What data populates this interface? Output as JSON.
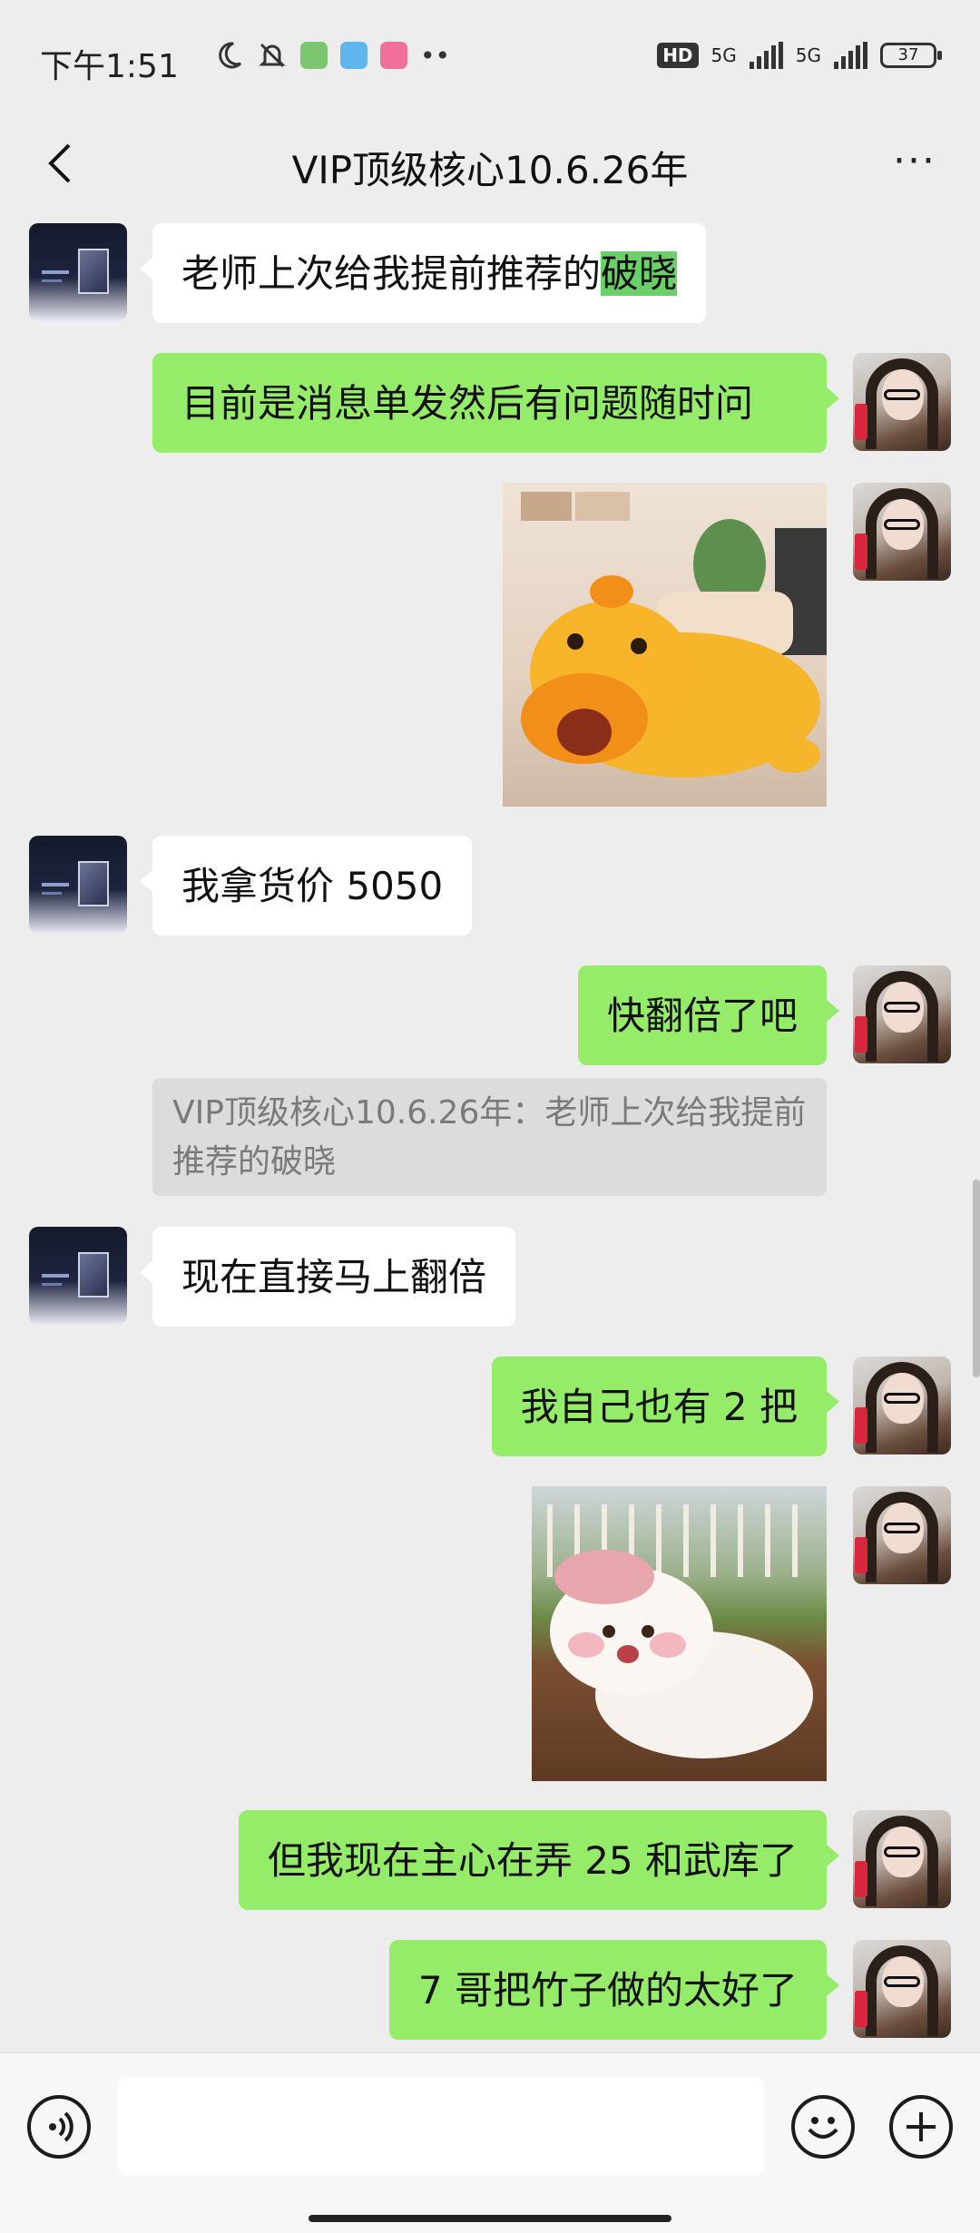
{
  "status_bar": {
    "time": "下午1:51",
    "hd_label": "HD",
    "net1": "5G",
    "net2": "5G",
    "battery": "37"
  },
  "header": {
    "title": "VIP顶级核心10.6.26年",
    "back_icon": "chevron-left-icon",
    "more_icon": "more-icon",
    "more_label": "···"
  },
  "messages": [
    {
      "side": "left",
      "type": "text",
      "text_before": "老师上次给我提前推荐的",
      "highlight": "破晓"
    },
    {
      "side": "right",
      "type": "text",
      "text": "目前是消息单发然后有问题随时问"
    },
    {
      "side": "right",
      "type": "sticker",
      "subject": "yellow-capybara-sticker"
    },
    {
      "side": "left",
      "type": "text",
      "text": "我拿货价 5050"
    },
    {
      "side": "right",
      "type": "text",
      "text": "快翻倍了吧"
    },
    {
      "type": "quote",
      "text": "VIP顶级核心10.6.26年：老师上次给我提前推荐的破晓"
    },
    {
      "side": "left",
      "type": "text",
      "text": "现在直接马上翻倍"
    },
    {
      "side": "right",
      "type": "text",
      "text": "我自己也有 2 把"
    },
    {
      "side": "right",
      "type": "sticker",
      "subject": "pink-hamster-sticker"
    },
    {
      "side": "right",
      "type": "text",
      "text": "但我现在主心在弄 25 和武库了"
    },
    {
      "side": "right",
      "type": "text",
      "text": "7 哥把竹子做的太好了"
    }
  ],
  "colors": {
    "background": "#ededed",
    "bubble_self": "#95ec69",
    "bubble_other": "#ffffff",
    "highlight": "#6bd06a"
  }
}
